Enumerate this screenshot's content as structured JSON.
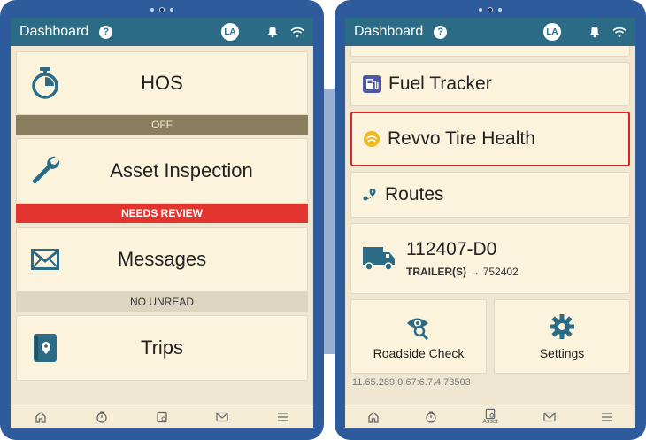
{
  "colors": {
    "bezel": "#2e5b9c",
    "statusbar": "#2b6b85",
    "tile": "#fcf3dc",
    "alert": "#e3342f",
    "highlight": "#d6262b"
  },
  "left": {
    "status": {
      "title": "Dashboard",
      "help": "?",
      "avatar": "LA"
    },
    "tiles": [
      {
        "label": "HOS",
        "icon": "stopwatch-icon",
        "banner": "OFF"
      },
      {
        "label": "Asset Inspection",
        "icon": "wrench-icon",
        "banner": "NEEDS REVIEW"
      },
      {
        "label": "Messages",
        "icon": "envelope-icon",
        "banner": "NO UNREAD"
      },
      {
        "label": "Trips",
        "icon": "trip-book-icon"
      }
    ],
    "nav": [
      "home-icon",
      "stopwatch-icon",
      "asset-icon",
      "mail-icon",
      "menu-icon"
    ]
  },
  "right": {
    "status": {
      "title": "Dashboard",
      "help": "?",
      "avatar": "LA"
    },
    "items": [
      {
        "label": "Fuel Tracker",
        "icon": "fuel-icon"
      },
      {
        "label": "Revvo Tire Health",
        "icon": "tire-icon"
      },
      {
        "label": "Routes",
        "icon": "route-icon"
      }
    ],
    "truck": {
      "number": "112407-D0",
      "trailer_label": "TRAILER(S)",
      "trailer_arrow": "→",
      "trailer_value": "752402"
    },
    "actions": [
      {
        "label": "Roadside Check",
        "icon": "eye-search-icon"
      },
      {
        "label": "Settings",
        "icon": "gear-icon"
      }
    ],
    "coords_text": "11.65.289:0.67:6.7.4.73503",
    "nav_asset_label": "Asset"
  }
}
